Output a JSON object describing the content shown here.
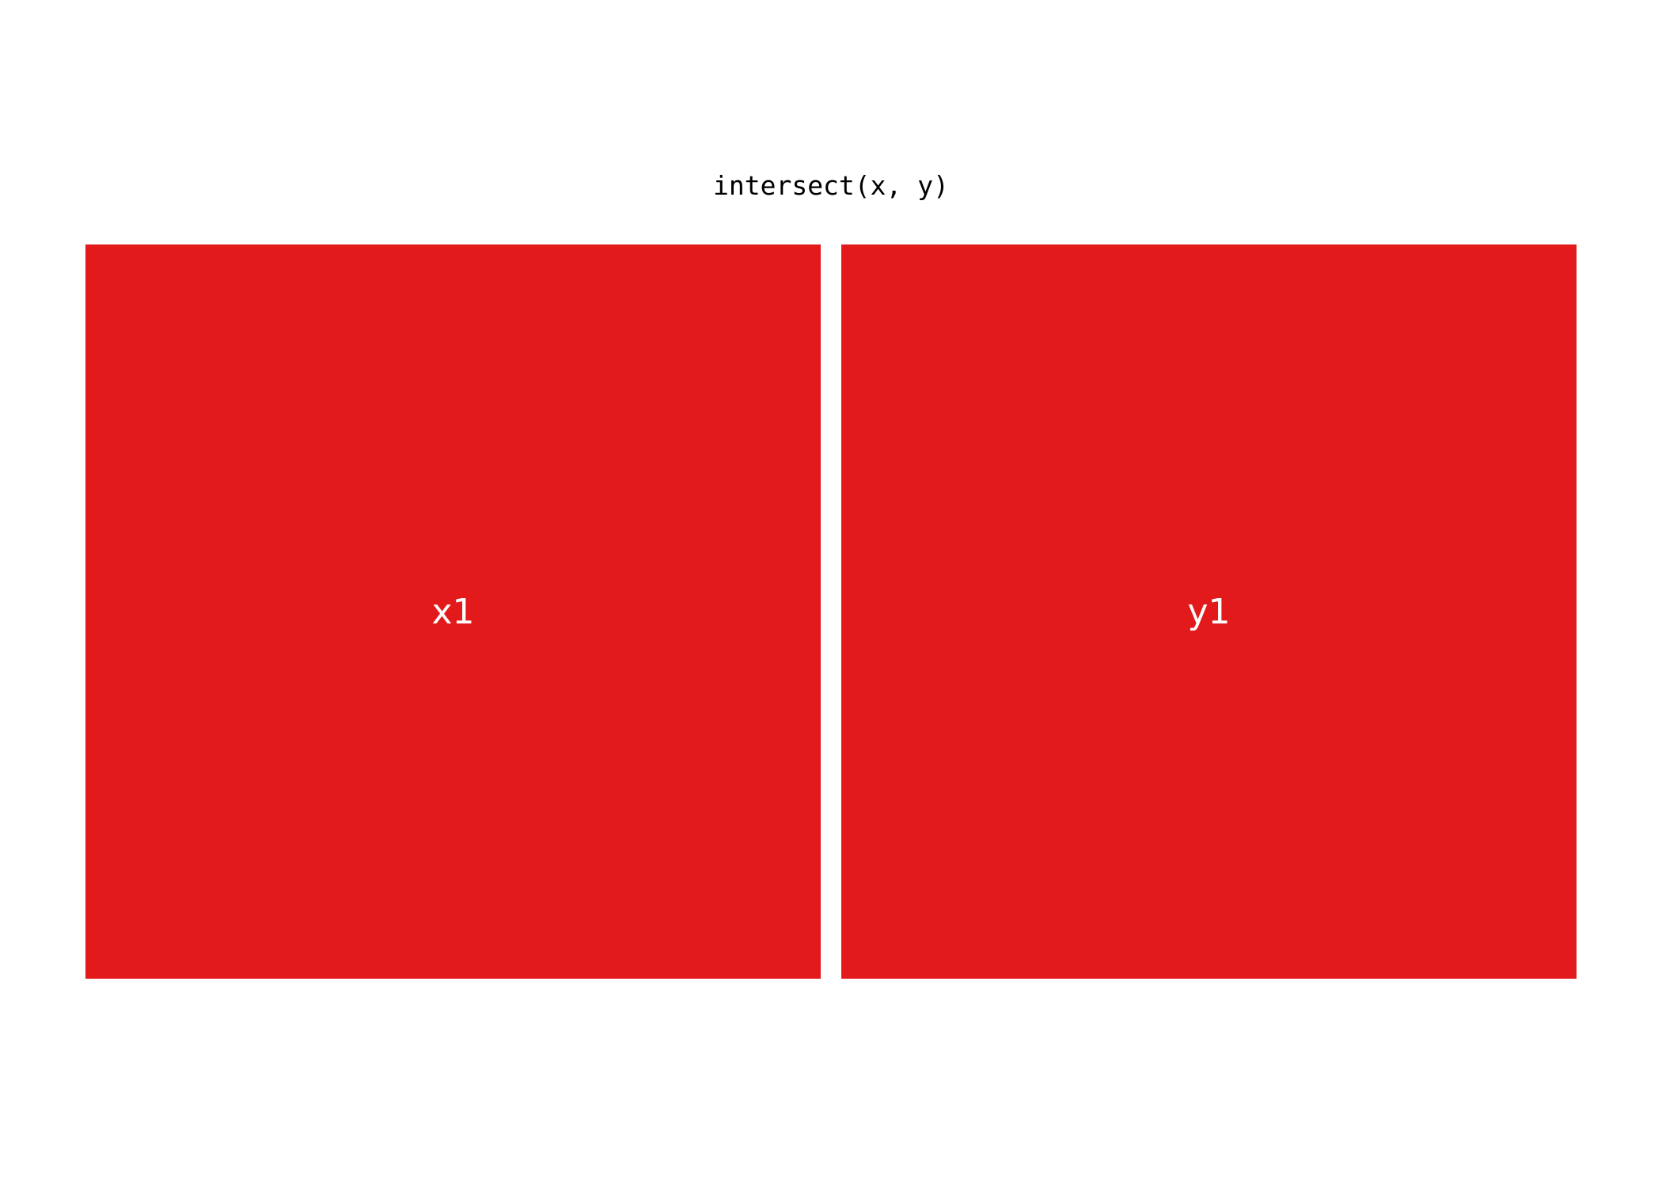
{
  "title": "intersect(x, y)",
  "colors": {
    "background": "#ffffff",
    "cell_fill": "#e31a1c",
    "label_text": "#ffffff",
    "title_text": "#000000"
  },
  "panels": [
    {
      "label": "x1"
    },
    {
      "label": "y1"
    }
  ]
}
